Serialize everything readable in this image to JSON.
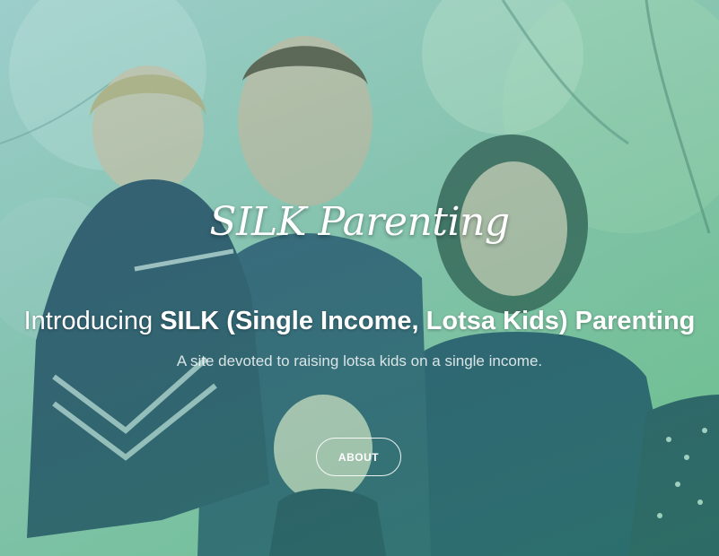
{
  "hero": {
    "logo_text": "SILK Parenting",
    "headline_prefix": "Introducing",
    "headline_bold": "SILK (Single Income, Lotsa Kids) Parenting",
    "tagline": "A site devoted to raising lotsa kids on a single income.",
    "button_label": "ABOUT",
    "overlay_color": "#4fb08a",
    "photo_subject": "family-photo"
  }
}
